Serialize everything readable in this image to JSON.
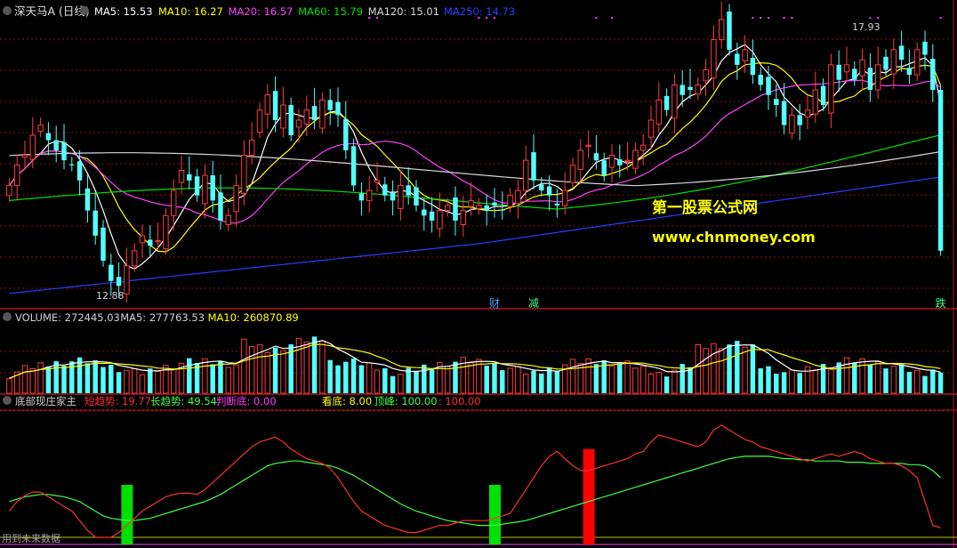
{
  "title": "深天马A (日线)",
  "colors": {
    "up": "#ff3b3b",
    "down": "#54ffff",
    "ma5": "#ffffff",
    "ma10": "#ffff00",
    "ma20": "#ff40ff",
    "ma60": "#00e000",
    "ma120": "#d8d8d8",
    "ma250": "#2a3cff",
    "grid": "#8a1010",
    "frame": "#b01818",
    "label": "#d0d0d0"
  },
  "price_panel": {
    "legend": [
      {
        "text": "MA5: 15.53",
        "color": "#ffffff"
      },
      {
        "text": "MA10: 16.27",
        "color": "#ffff00"
      },
      {
        "text": "MA20: 16.57",
        "color": "#ff40ff"
      },
      {
        "text": "MA60: 15.79",
        "color": "#00e000"
      },
      {
        "text": "MA120: 15.01",
        "color": "#d8d8d8"
      },
      {
        "text": "MA250: 14.73",
        "color": "#2a3cff"
      }
    ],
    "high_marker": "17.93",
    "low_marker": "12.88",
    "event_labels": [
      {
        "text": "财",
        "color": "#40a0ff",
        "bar": 62
      },
      {
        "text": "减",
        "color": "#40ff80",
        "bar": 67
      },
      {
        "text": "跌",
        "color": "#40ff80",
        "bar": 119
      }
    ],
    "watermark_title": "第一股票公式网",
    "watermark_url": "www.chnmoney.com"
  },
  "volume_panel": {
    "legend": [
      {
        "text": "VOLUME: 272445.03",
        "color": "#d0d0d0"
      },
      {
        "text": "MA5: 277763.53",
        "color": "#d0d0d0"
      },
      {
        "text": "MA10: 260870.89",
        "color": "#ffff00"
      }
    ]
  },
  "indicator_panel": {
    "name": "底部现庄家主",
    "legend": [
      {
        "text": "短趋势: 19.77",
        "color": "#ff3030"
      },
      {
        "text": "长趋势: 49.54",
        "color": "#40ff40"
      },
      {
        "text": "判断底: 0.00",
        "color": "#ff40ff"
      },
      {
        "text": "看底: 8.00",
        "color": "#ffff00"
      },
      {
        "text": "顶峰: 100.00",
        "color": "#40ff40"
      },
      {
        "text": ": 100.00",
        "color": "#ff3030"
      }
    ],
    "footer_note": "用到未来数据"
  },
  "chart_data": [
    {
      "type": "candlestick",
      "title": "深天马A (日线)",
      "price_range": [
        12.5,
        18.2
      ],
      "annotations": [
        "17.93",
        "12.88"
      ],
      "series_values_desc": "OHLC per bar, estimated from the chart",
      "closes": [
        14.9,
        15.3,
        15.5,
        15.9,
        16.1,
        15.8,
        15.6,
        15.4,
        15.3,
        15.0,
        14.4,
        13.9,
        13.4,
        13.0,
        12.9,
        13.3,
        13.6,
        13.9,
        13.7,
        13.8,
        14.3,
        14.8,
        15.2,
        15.0,
        14.7,
        15.1,
        14.6,
        14.2,
        14.3,
        14.9,
        15.5,
        15.8,
        16.4,
        16.7,
        16.2,
        16.5,
        15.9,
        16.2,
        16.4,
        16.2,
        16.6,
        16.4,
        16.3,
        15.6,
        14.9,
        14.6,
        14.8,
        15.0,
        14.7,
        14.6,
        14.9,
        14.7,
        14.5,
        14.3,
        14.2,
        14.4,
        14.5,
        14.2,
        14.4,
        14.6,
        14.5,
        14.4,
        14.5,
        14.4,
        14.7,
        14.8,
        15.4,
        15.0,
        14.8,
        14.7,
        14.5,
        14.8,
        15.3,
        15.6,
        15.7,
        15.4,
        15.1,
        15.5,
        15.3,
        15.4,
        15.6,
        15.7,
        16.2,
        16.6,
        16.4,
        16.9,
        16.7,
        16.8,
        16.9,
        17.2,
        17.8,
        18.2,
        17.6,
        17.3,
        17.6,
        17.1,
        16.9,
        16.7,
        16.5,
        16.1,
        16.3,
        16.1,
        16.4,
        16.8,
        16.5,
        17.3,
        17.0,
        17.3,
        17.0,
        17.4,
        16.8,
        17.3,
        17.2,
        17.6,
        17.4,
        17.1,
        17.6,
        17.5,
        16.8,
        13.6
      ]
    },
    {
      "type": "bar",
      "title": "VOLUME",
      "series": [
        {
          "name": "VOLUME",
          "values": "see script (estimated per bar)"
        },
        {
          "name": "MA5",
          "last": 277763.53
        },
        {
          "name": "MA10",
          "last": 260870.89
        }
      ]
    },
    {
      "type": "line",
      "title": "底部现庄家主",
      "ylim": [
        0,
        100
      ],
      "series": [
        {
          "name": "短趋势",
          "color": "#ff3030",
          "values": [
            22,
            30,
            35,
            38,
            38,
            34,
            30,
            26,
            22,
            14,
            6,
            0,
            0,
            0,
            4,
            10,
            16,
            22,
            26,
            30,
            34,
            36,
            37,
            37,
            36,
            40,
            46,
            52,
            58,
            64,
            70,
            76,
            80,
            82,
            84,
            80,
            74,
            70,
            66,
            64,
            62,
            58,
            50,
            40,
            30,
            22,
            18,
            14,
            10,
            8,
            6,
            4,
            4,
            6,
            8,
            10,
            10,
            12,
            14,
            14,
            14,
            14,
            16,
            18,
            20,
            30,
            40,
            50,
            60,
            68,
            72,
            66,
            60,
            56,
            56,
            58,
            60,
            62,
            64,
            66,
            70,
            72,
            80,
            86,
            84,
            82,
            80,
            78,
            76,
            80,
            90,
            94,
            90,
            86,
            82,
            80,
            76,
            74,
            72,
            70,
            68,
            66,
            64,
            66,
            68,
            70,
            68,
            70,
            72,
            70,
            66,
            64,
            62,
            62,
            60,
            56,
            50,
            30,
            10,
            8
          ]
        },
        {
          "name": "长趋势",
          "color": "#40ff40",
          "values": [
            30,
            32,
            34,
            35,
            36,
            36,
            35,
            34,
            32,
            30,
            26,
            22,
            18,
            16,
            15,
            14,
            14,
            15,
            16,
            18,
            20,
            22,
            24,
            26,
            28,
            30,
            33,
            36,
            40,
            44,
            48,
            52,
            56,
            60,
            62,
            63,
            64,
            64,
            63,
            62,
            61,
            60,
            58,
            55,
            52,
            48,
            44,
            40,
            36,
            32,
            28,
            25,
            22,
            20,
            18,
            16,
            14,
            13,
            12,
            11,
            10,
            10,
            10,
            11,
            12,
            13,
            14,
            16,
            18,
            20,
            22,
            24,
            26,
            28,
            30,
            32,
            34,
            36,
            38,
            40,
            42,
            44,
            46,
            48,
            50,
            52,
            54,
            56,
            58,
            60,
            62,
            64,
            66,
            67,
            68,
            68,
            68,
            68,
            67,
            66,
            66,
            65,
            65,
            64,
            64,
            64,
            64,
            63,
            63,
            63,
            62,
            62,
            62,
            62,
            62,
            61,
            61,
            60,
            56,
            50
          ]
        },
        {
          "name": "判断底",
          "bars": [
            {
              "bar": 15,
              "color": "#00e000",
              "height": 20
            },
            {
              "bar": 62,
              "color": "#00e000",
              "height": 20
            },
            {
              "bar": 74,
              "color": "#ff0000",
              "height": 32
            }
          ]
        }
      ]
    }
  ]
}
